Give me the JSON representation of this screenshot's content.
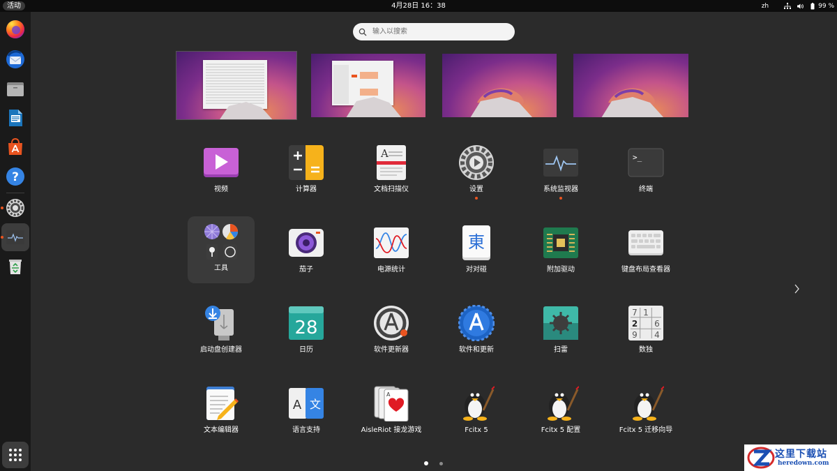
{
  "topbar": {
    "activities": "活动",
    "clock": "4月28日  16：38",
    "lang": "zh",
    "battery": "99 %"
  },
  "search": {
    "placeholder": "输入以搜索"
  },
  "apps": [
    {
      "label": "视频"
    },
    {
      "label": "计算器"
    },
    {
      "label": "文档扫描仪"
    },
    {
      "label": "设置"
    },
    {
      "label": "系统监视器"
    },
    {
      "label": "终端"
    },
    {
      "label": "工具"
    },
    {
      "label": "茄子"
    },
    {
      "label": "电源统计"
    },
    {
      "label": "对对碰"
    },
    {
      "label": "附加驱动"
    },
    {
      "label": "键盘布局查看器"
    },
    {
      "label": "启动盘创建器"
    },
    {
      "label": "日历"
    },
    {
      "label": "软件更新器"
    },
    {
      "label": "软件和更新"
    },
    {
      "label": "扫雷"
    },
    {
      "label": "数独"
    },
    {
      "label": "文本编辑器"
    },
    {
      "label": "语言支持"
    },
    {
      "label": "AisleRiot 接龙游戏"
    },
    {
      "label": "Fcitx 5"
    },
    {
      "label": "Fcitx 5 配置"
    },
    {
      "label": "Fcitx 5 迁移向导"
    }
  ],
  "icons": {
    "calendar_day": "28",
    "terminal_prompt": ">_",
    "mahjong_char": "東",
    "sudoku": [
      "7",
      "1",
      "",
      "2",
      "",
      "6",
      "9",
      "",
      "4"
    ],
    "lang_a": "A",
    "lang_wen": "文"
  },
  "watermark": {
    "title": "这里下载站",
    "sub": "heredown.com"
  },
  "colors": {
    "accent": "#e95420",
    "background": "#2b2b2b"
  }
}
